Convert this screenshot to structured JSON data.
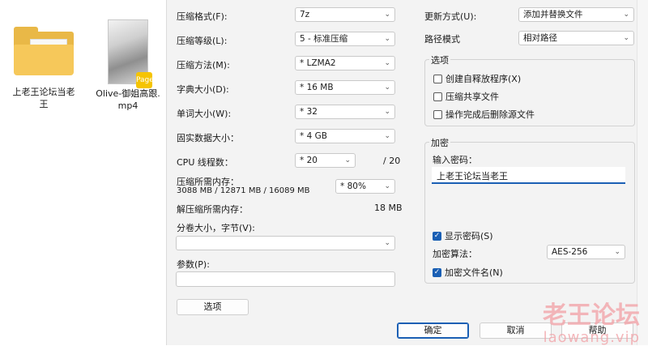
{
  "desktop": {
    "folder": {
      "label_line1": "上老王论坛当老",
      "label_line2": "王"
    },
    "video": {
      "label_line1": "Olive-御姐高跟.",
      "label_line2": "mp4",
      "badge": "Page"
    }
  },
  "dialog": {
    "archive_format": {
      "label": "压缩格式(F):",
      "value": "7z"
    },
    "compression_level": {
      "label": "压缩等级(L):",
      "value": "5 - 标准压缩"
    },
    "compression_method": {
      "label": "压缩方法(M):",
      "value": "* LZMA2"
    },
    "dictionary_size": {
      "label": "字典大小(D):",
      "value": "* 16 MB"
    },
    "word_size": {
      "label": "单词大小(W):",
      "value": "* 32"
    },
    "solid_block_size": {
      "label": "固实数据大小：",
      "value": "* 4 GB"
    },
    "cpu_threads": {
      "label": "CPU 线程数：",
      "value": "* 20",
      "max": "/ 20"
    },
    "memory_compress": {
      "label": "压缩所需内存：",
      "detail": "3088 MB / 12871 MB / 16089 MB",
      "value": "* 80%"
    },
    "memory_decompress": {
      "label": "解压缩所需内存：",
      "value": "18 MB"
    },
    "split_volumes": {
      "label": "分卷大小，字节(V):",
      "value": ""
    },
    "parameters": {
      "label": "参数(P):",
      "value": ""
    },
    "options_button": "选项",
    "update_mode": {
      "label": "更新方式(U):",
      "value": "添加并替换文件"
    },
    "path_mode": {
      "label": "路径模式",
      "value": "相对路径"
    },
    "options_group": {
      "title": "选项",
      "sfx": "创建自释放程序(X)",
      "shared": "压缩共享文件",
      "delete_after": "操作完成后删除源文件"
    },
    "encryption_group": {
      "title": "加密",
      "password_label": "输入密码：",
      "password_value": "上老王论坛当老王",
      "show_password": "显示密码(S)",
      "method_label": "加密算法：",
      "method_value": "AES-256",
      "encrypt_names": "加密文件名(N)"
    },
    "buttons": {
      "ok": "确定",
      "cancel": "取消",
      "help": "帮助"
    }
  },
  "watermark": {
    "title": "老王论坛",
    "url": "laowang.vip"
  }
}
